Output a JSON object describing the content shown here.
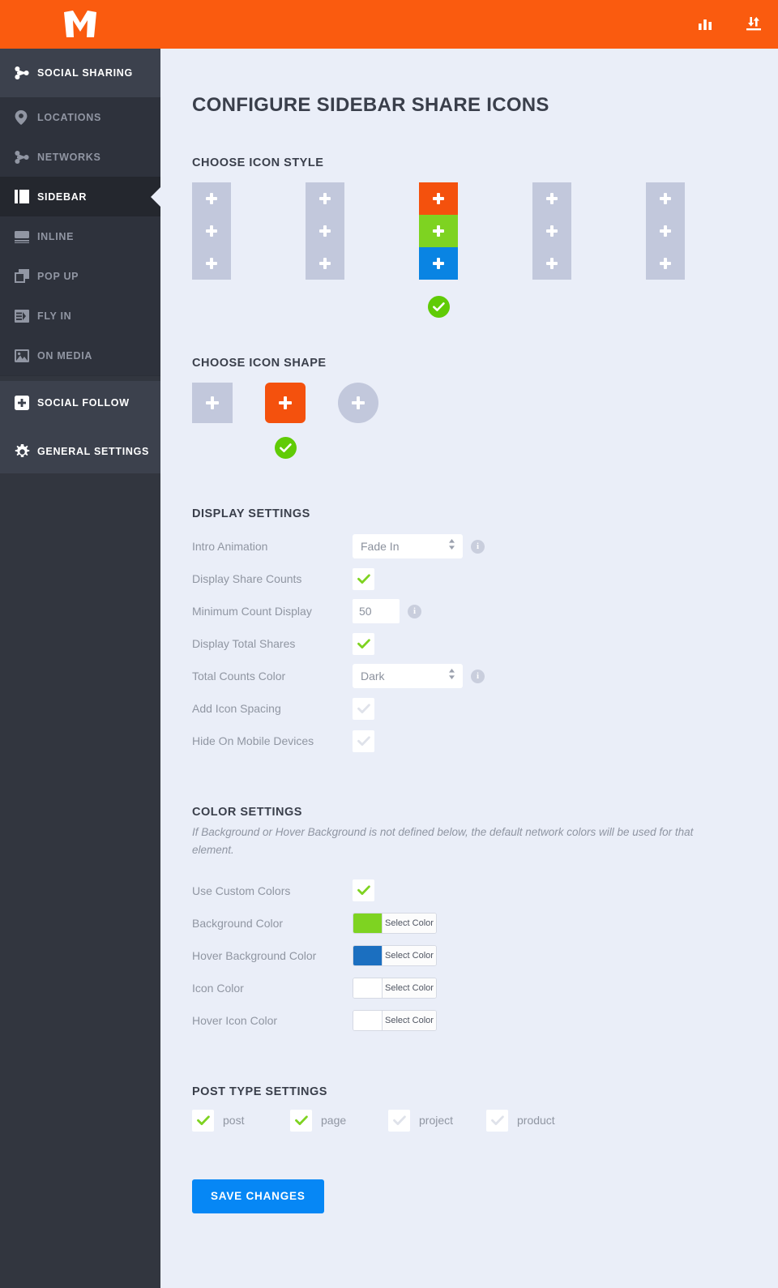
{
  "topbar": {
    "logo_alt": "M",
    "brand_color": "#fa5b0f",
    "actions": [
      {
        "name": "analytics-icon",
        "label": "Analytics"
      },
      {
        "name": "import-export-icon",
        "label": "Import / Export"
      }
    ]
  },
  "sidebar": {
    "header": {
      "label": "SOCIAL SHARING",
      "icon": "share-nodes-icon"
    },
    "items": [
      {
        "label": "LOCATIONS",
        "icon": "location-pin-icon",
        "active": false
      },
      {
        "label": "NETWORKS",
        "icon": "share-nodes-icon",
        "active": false
      },
      {
        "label": "SIDEBAR",
        "icon": "sidebar-icon",
        "active": true
      },
      {
        "label": "INLINE",
        "icon": "inline-icon",
        "active": false
      },
      {
        "label": "POP UP",
        "icon": "popup-icon",
        "active": false
      },
      {
        "label": "FLY IN",
        "icon": "flyin-icon",
        "active": false
      },
      {
        "label": "ON MEDIA",
        "icon": "on-media-icon",
        "active": false
      }
    ],
    "bottom_items": [
      {
        "label": "SOCIAL FOLLOW",
        "icon": "plus-square-icon"
      },
      {
        "label": "GENERAL SETTINGS",
        "icon": "gear-icon"
      }
    ]
  },
  "main": {
    "page_title": "CONFIGURE SIDEBAR SHARE ICONS",
    "icon_style": {
      "title": "CHOOSE ICON STYLE",
      "selected_index": 2,
      "options": [
        {
          "name": "style-1",
          "colors": [
            "#c2c8dc",
            "#c2c8dc",
            "#c2c8dc"
          ]
        },
        {
          "name": "style-2",
          "colors": [
            "#c2c8dc",
            "#c2c8dc",
            "#c2c8dc"
          ]
        },
        {
          "name": "style-3",
          "colors": [
            "#f4510d",
            "#7ed321",
            "#0984e3"
          ]
        },
        {
          "name": "style-4",
          "colors": [
            "#c2c8dc",
            "#c2c8dc",
            "#c2c8dc"
          ]
        },
        {
          "name": "style-5",
          "colors": [
            "#c2c8dc",
            "#c2c8dc",
            "#c2c8dc"
          ]
        }
      ]
    },
    "icon_shape": {
      "title": "CHOOSE ICON SHAPE",
      "selected_index": 1,
      "options": [
        {
          "name": "square",
          "radius": "0px",
          "color": "#c2c8dc"
        },
        {
          "name": "rounded",
          "radius": "6px",
          "color": "#f4510d"
        },
        {
          "name": "circle",
          "radius": "50%",
          "color": "#c2c8dc"
        }
      ]
    },
    "display_settings": {
      "title": "DISPLAY SETTINGS",
      "rows": [
        {
          "label": "Intro Animation",
          "type": "select",
          "value": "Fade In",
          "options": [
            "Fade In"
          ],
          "info": true
        },
        {
          "label": "Display Share Counts",
          "type": "checkbox",
          "checked": true,
          "info": false
        },
        {
          "label": "Minimum Count Display",
          "type": "number",
          "value": "50",
          "info": true
        },
        {
          "label": "Display Total Shares",
          "type": "checkbox",
          "checked": true,
          "info": false
        },
        {
          "label": "Total Counts Color",
          "type": "select",
          "value": "Dark",
          "options": [
            "Dark"
          ],
          "info": true
        },
        {
          "label": "Add Icon Spacing",
          "type": "checkbox",
          "checked": false,
          "info": false
        },
        {
          "label": "Hide On Mobile Devices",
          "type": "checkbox",
          "checked": false,
          "info": false
        }
      ]
    },
    "color_settings": {
      "title": "COLOR SETTINGS",
      "helper": "If Background or Hover Background is not defined below, the default network colors will be used for that element.",
      "use_custom": {
        "label": "Use Custom Colors",
        "checked": true
      },
      "rows": [
        {
          "label": "Background Color",
          "swatch": "#7ed321",
          "button": "Select Color"
        },
        {
          "label": "Hover Background Color",
          "swatch": "#1b6fc0",
          "button": "Select Color"
        },
        {
          "label": "Icon Color",
          "swatch": "#ffffff",
          "button": "Select Color"
        },
        {
          "label": "Hover Icon Color",
          "swatch": "#ffffff",
          "button": "Select Color"
        }
      ]
    },
    "post_types": {
      "title": "POST TYPE SETTINGS",
      "items": [
        {
          "label": "post",
          "checked": true
        },
        {
          "label": "page",
          "checked": true
        },
        {
          "label": "project",
          "checked": false
        },
        {
          "label": "product",
          "checked": false
        }
      ]
    },
    "save_label": "SAVE CHANGES"
  },
  "colors": {
    "orange": "#fa5b0f",
    "green_check": "#60cb06",
    "save_blue": "#0687f5",
    "bg": "#eaeef8",
    "sidebar_dark": "#32363f"
  }
}
